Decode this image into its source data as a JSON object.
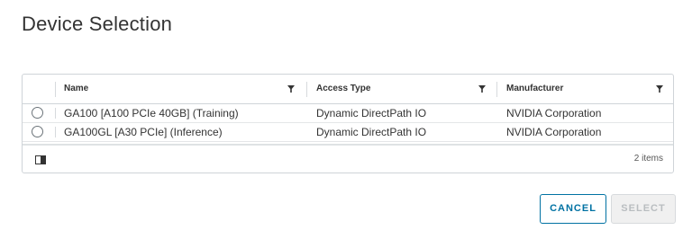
{
  "dialog": {
    "title": "Device Selection"
  },
  "table": {
    "columns": [
      {
        "label": "Name"
      },
      {
        "label": "Access Type"
      },
      {
        "label": "Manufacturer"
      }
    ],
    "rows": [
      {
        "name": "GA100 [A100 PCIe 40GB] (Training)",
        "access_type": "Dynamic DirectPath IO",
        "manufacturer": "NVIDIA Corporation",
        "selected": false
      },
      {
        "name": "GA100GL [A30 PCIe] (Inference)",
        "access_type": "Dynamic DirectPath IO",
        "manufacturer": "NVIDIA Corporation",
        "selected": false
      }
    ],
    "footer": {
      "count_label": "2 items",
      "column_toggle_icon": "column-toggle-icon"
    }
  },
  "actions": {
    "cancel_label": "CANCEL",
    "select_label": "SELECT"
  },
  "colors": {
    "primary": "#0072a3",
    "disabled_text": "#b9bdc0",
    "border": "#cfd4d8"
  }
}
